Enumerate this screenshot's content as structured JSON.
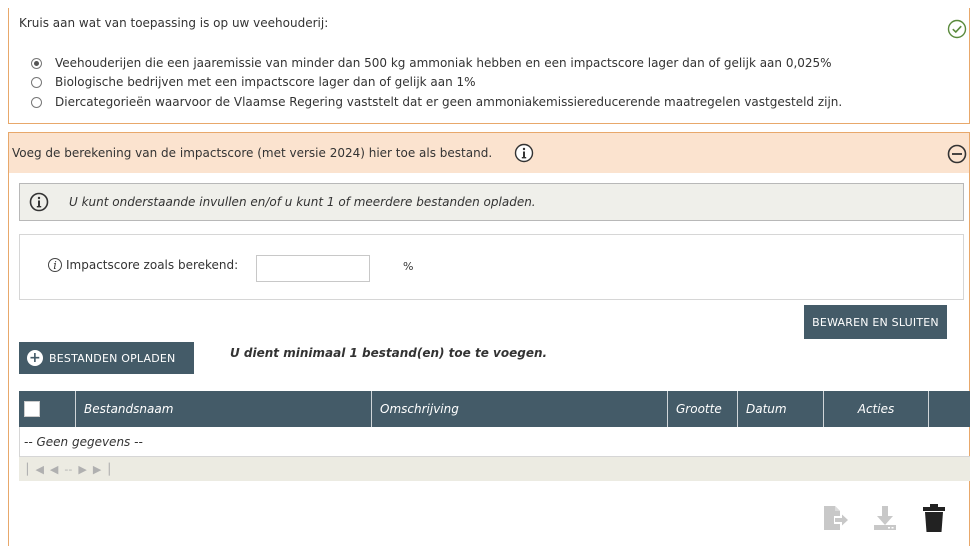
{
  "section1": {
    "title": "Kruis aan wat van toepassing is op uw veehouderij:",
    "options": [
      {
        "label": "Veehouderijen die een jaaremissie van minder dan 500 kg ammoniak hebben en een impactscore lager dan of gelijk aan 0,025%",
        "checked": true
      },
      {
        "label": "Biologische bedrijven met een impactscore lager dan of gelijk aan 1%",
        "checked": false
      },
      {
        "label": "Diercategorieën waarvoor de Vlaamse Regering vaststelt dat er geen ammoniakemissiereducerende maatregelen vastgesteld zijn.",
        "checked": false
      }
    ]
  },
  "section2": {
    "title": "Voeg de berekening van de impactscore (met versie 2024) hier toe als bestand.",
    "alert": "U kunt onderstaande invullen en/of u kunt 1 of meerdere bestanden opladen.",
    "form": {
      "info_glyph": "i",
      "label": "Impactscore zoals berekend:",
      "value": "",
      "unit": "%"
    },
    "save_button": "BEWAREN EN SLUITEN",
    "upload_button": "BESTANDEN OPLADEN",
    "upload_note": "U dient minimaal 1 bestand(en) toe te voegen.",
    "table": {
      "columns": [
        "Bestandsnaam",
        "Omschrijving",
        "Grootte",
        "Datum",
        "Acties"
      ],
      "empty_text": "-- Geen gegevens --",
      "pager_text": "--"
    }
  },
  "colors": {
    "accent_orange": "#e8a86b",
    "header_bg": "#fbe3cf",
    "button_dark": "#445b68",
    "icon_green": "#5a8a3c"
  },
  "icons": [
    "check-circle-icon",
    "info-icon",
    "minus-circle-icon",
    "plus-circle-icon",
    "export-icon",
    "download-icon",
    "trash-icon"
  ]
}
